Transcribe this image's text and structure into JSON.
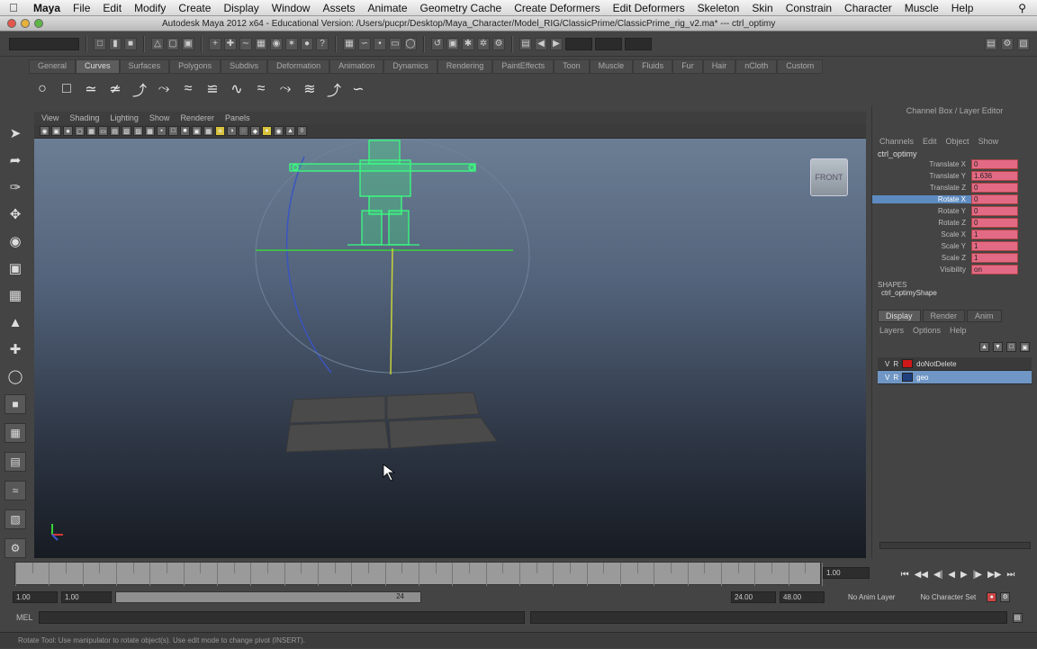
{
  "menubar": {
    "app": "Maya",
    "items": [
      "File",
      "Edit",
      "Modify",
      "Create",
      "Display",
      "Window",
      "Assets",
      "Animate",
      "Geometry Cache",
      "Create Deformers",
      "Edit Deformers",
      "Skeleton",
      "Skin",
      "Constrain",
      "Character",
      "Muscle",
      "Help"
    ]
  },
  "titlebar": {
    "title": "Autodesk Maya 2012 x64 - Educational Version: /Users/pucpr/Desktop/Maya_Character/Model_RIG/ClassicPrime/ClassicPrime_rig_v2.ma*   ---   ctrl_optimy"
  },
  "shelf": {
    "tabs": [
      "General",
      "Curves",
      "Surfaces",
      "Polygons",
      "Subdivs",
      "Deformation",
      "Animation",
      "Dynamics",
      "Rendering",
      "PaintEffects",
      "Toon",
      "Muscle",
      "Fluids",
      "Fur",
      "Hair",
      "nCloth",
      "Custom"
    ],
    "active_tab": "Curves"
  },
  "viewport": {
    "menus": [
      "View",
      "Shading",
      "Lighting",
      "Show",
      "Renderer",
      "Panels"
    ],
    "viewcube_label": "FRONT"
  },
  "channelbox": {
    "header": "Channel Box / Layer Editor",
    "menus": [
      "Channels",
      "Edit",
      "Object",
      "Show"
    ],
    "object_name": "ctrl_optimy",
    "channels": [
      {
        "name": "Translate X",
        "value": "0"
      },
      {
        "name": "Translate Y",
        "value": "1.636"
      },
      {
        "name": "Translate Z",
        "value": "0"
      },
      {
        "name": "Rotate X",
        "value": "0"
      },
      {
        "name": "Rotate Y",
        "value": "0"
      },
      {
        "name": "Rotate Z",
        "value": "0"
      },
      {
        "name": "Scale X",
        "value": "1"
      },
      {
        "name": "Scale Y",
        "value": "1"
      },
      {
        "name": "Scale Z",
        "value": "1"
      },
      {
        "name": "Visibility",
        "value": "on"
      }
    ],
    "selected_channel": "Rotate X",
    "shapes_label": "SHAPES",
    "shape_name": "ctrl_optimyShape"
  },
  "layereditor": {
    "tabs": [
      "Display",
      "Render",
      "Anim"
    ],
    "active_tab": "Display",
    "menus": [
      "Layers",
      "Options",
      "Help"
    ],
    "layers": [
      {
        "v": "V",
        "p": "R",
        "name": "doNotDelete",
        "color": "#d01818"
      },
      {
        "v": "V",
        "p": "R",
        "name": "geo",
        "color": "#1f3f7f"
      }
    ],
    "selected_layer": "geo"
  },
  "timeline": {
    "current_frame": "1.00",
    "range_start_outer": "1.00",
    "range_start_inner": "1.00",
    "range_inner_value": "24",
    "range_end_inner": "24.00",
    "range_end_outer": "48.00",
    "anim_layer": "No Anim Layer",
    "character_set": "No Character Set"
  },
  "commandline": {
    "label": "MEL"
  },
  "helpline": {
    "text": "Rotate Tool: Use manipulator to rotate object(s). Use edit mode to change pivot (INSERT)."
  },
  "colors": {
    "accent_select": "#5d8bbf",
    "channel_keyed": "#e36a85",
    "rig_green": "#39ff7f"
  }
}
